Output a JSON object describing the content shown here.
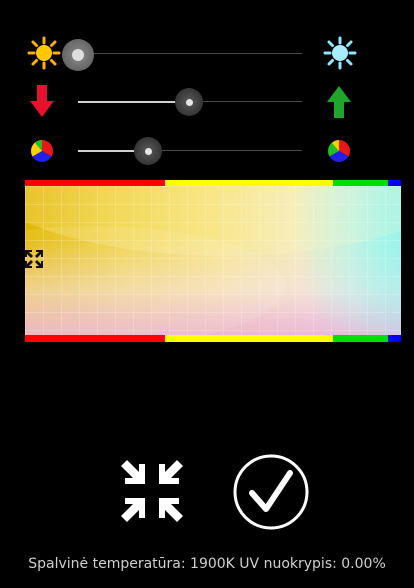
{
  "controls": {
    "brightness": {
      "level": 0.0
    },
    "uv_offset": {
      "level": 0.5
    },
    "color_balance": {
      "level": 0.31
    }
  },
  "band_colors": [
    "#ff0000",
    "#ffff00",
    "#00e000",
    "#0000ff"
  ],
  "status": {
    "text": "Spalvinė temperatūra: 1900K UV nuokrypis: 0.00%"
  }
}
